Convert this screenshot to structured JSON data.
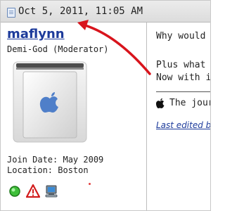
{
  "post": {
    "date_icon": "document-icon",
    "date": "Oct 5, 2011, 11:05 AM"
  },
  "user": {
    "name": "maflynn",
    "title": "Demi-God (Moderator)",
    "avatar": "power-mac-g4-cube-icon",
    "join_date": "Join Date: May 2009",
    "location": "Location: Boston",
    "status_icons": [
      "online-status-icon",
      "report-post-icon",
      "computer-icon"
    ]
  },
  "content": {
    "line1": "Why would",
    "line2": "Plus what a",
    "line3": "Now with i",
    "signature": "The jour",
    "signature_icon": "apple-logo-icon",
    "edited": "Last edited b"
  },
  "colors": {
    "username_link": "#1d3b9b",
    "annotation_arrow": "#d8141c",
    "header_bg": "#e4e4e4"
  }
}
